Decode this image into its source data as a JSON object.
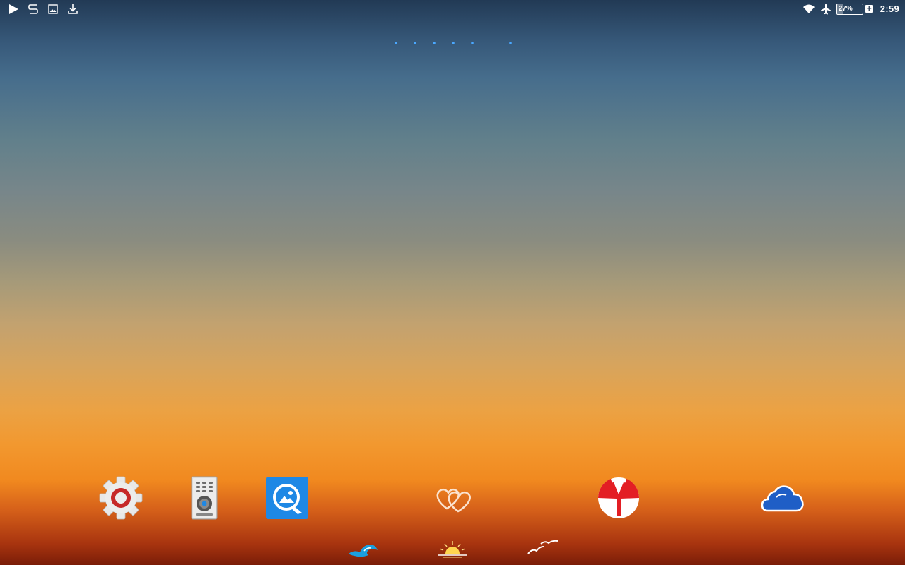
{
  "status_bar": {
    "left_icons": [
      "play-store-icon",
      "s-app-icon",
      "gallery-icon",
      "download-icon"
    ],
    "right_icons": [
      "wifi-icon",
      "airplane-icon",
      "battery-icon",
      "charging-icon"
    ],
    "battery_percent": "27%",
    "battery_level": 0.27,
    "time": "2:59"
  },
  "page_indicator": {
    "pages": 7,
    "current_page": 6,
    "current_icon": "moon-icon",
    "other_icon": "star-icon"
  },
  "apps": [
    {
      "name": "settings-app-icon"
    },
    {
      "name": "remote-control-app-icon"
    },
    {
      "name": "quickpic-gallery-app-icon"
    },
    {
      "name": "hearts-app-icon"
    },
    {
      "name": "yandex-browser-app-icon"
    },
    {
      "name": "onedrive-cloud-app-icon"
    }
  ],
  "bottom_row": [
    "wave-icon",
    "sunset-icon",
    "seagulls-icon"
  ],
  "colors": {
    "accent_blue": "#1e88e5",
    "yandex_red": "#e31e24",
    "onedrive_blue": "#1f5ec6"
  }
}
